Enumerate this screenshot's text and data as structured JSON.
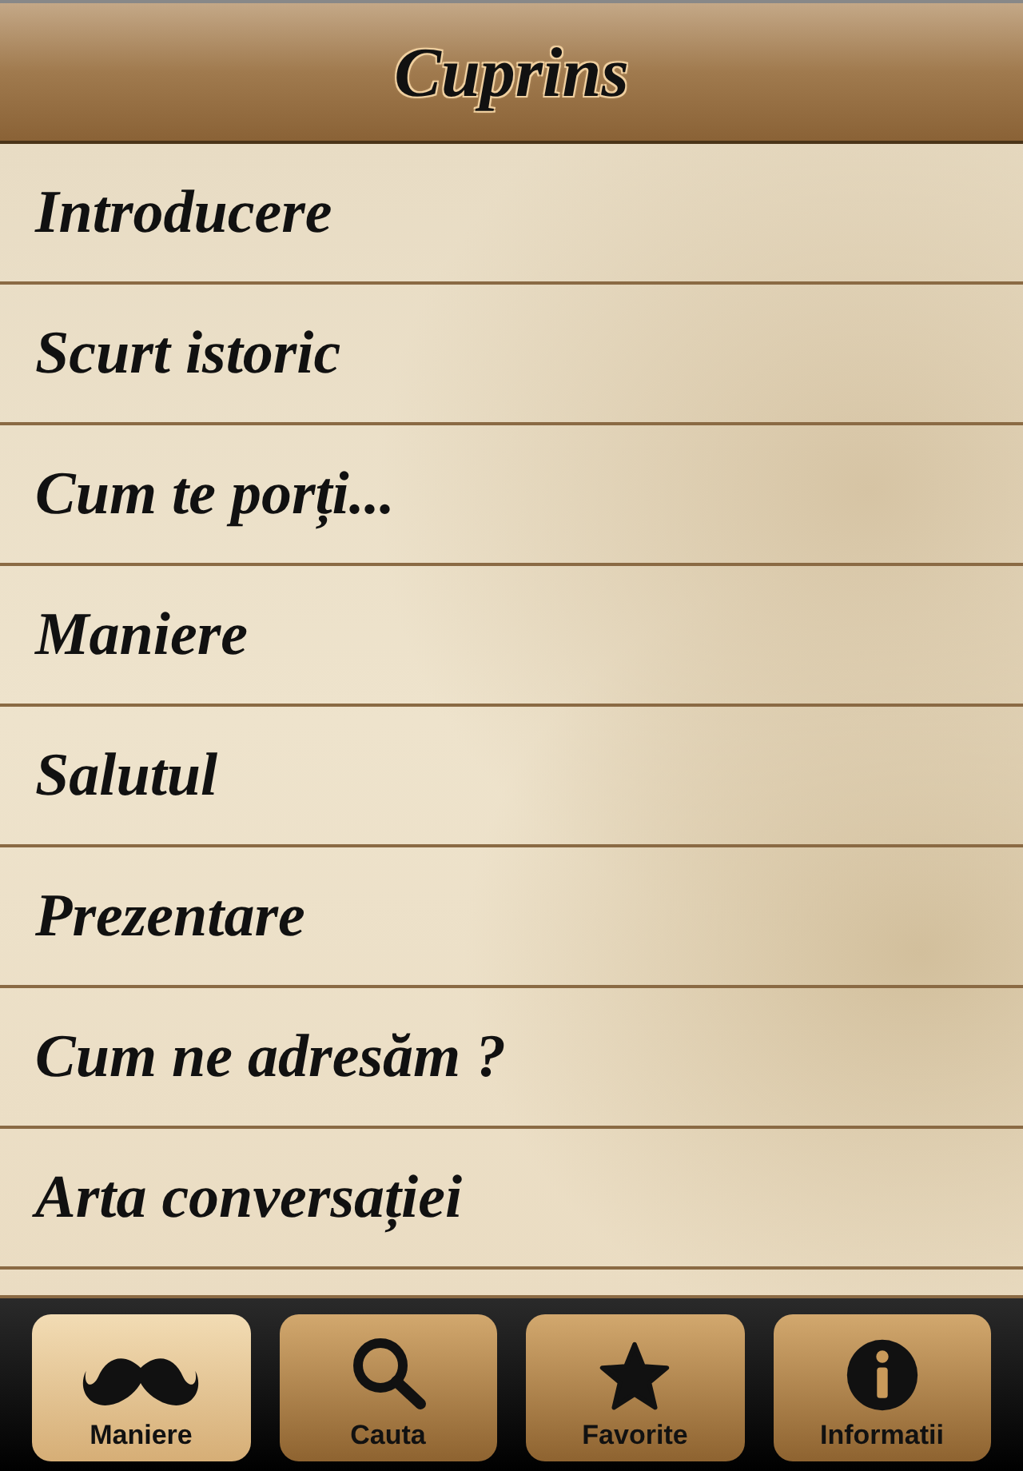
{
  "header": {
    "title": "Cuprins"
  },
  "items": [
    {
      "label": "Introducere"
    },
    {
      "label": "Scurt istoric"
    },
    {
      "label": "Cum te porți..."
    },
    {
      "label": "Maniere"
    },
    {
      "label": "Salutul"
    },
    {
      "label": "Prezentare"
    },
    {
      "label": "Cum ne adresăm ?"
    },
    {
      "label": "Arta conversației"
    }
  ],
  "tabs": [
    {
      "label": "Maniere",
      "kind": "mustache",
      "selected": true
    },
    {
      "label": "Cauta",
      "kind": "search",
      "selected": false
    },
    {
      "label": "Favorite",
      "kind": "star",
      "selected": false
    },
    {
      "label": "Informatii",
      "kind": "info",
      "selected": false
    }
  ]
}
